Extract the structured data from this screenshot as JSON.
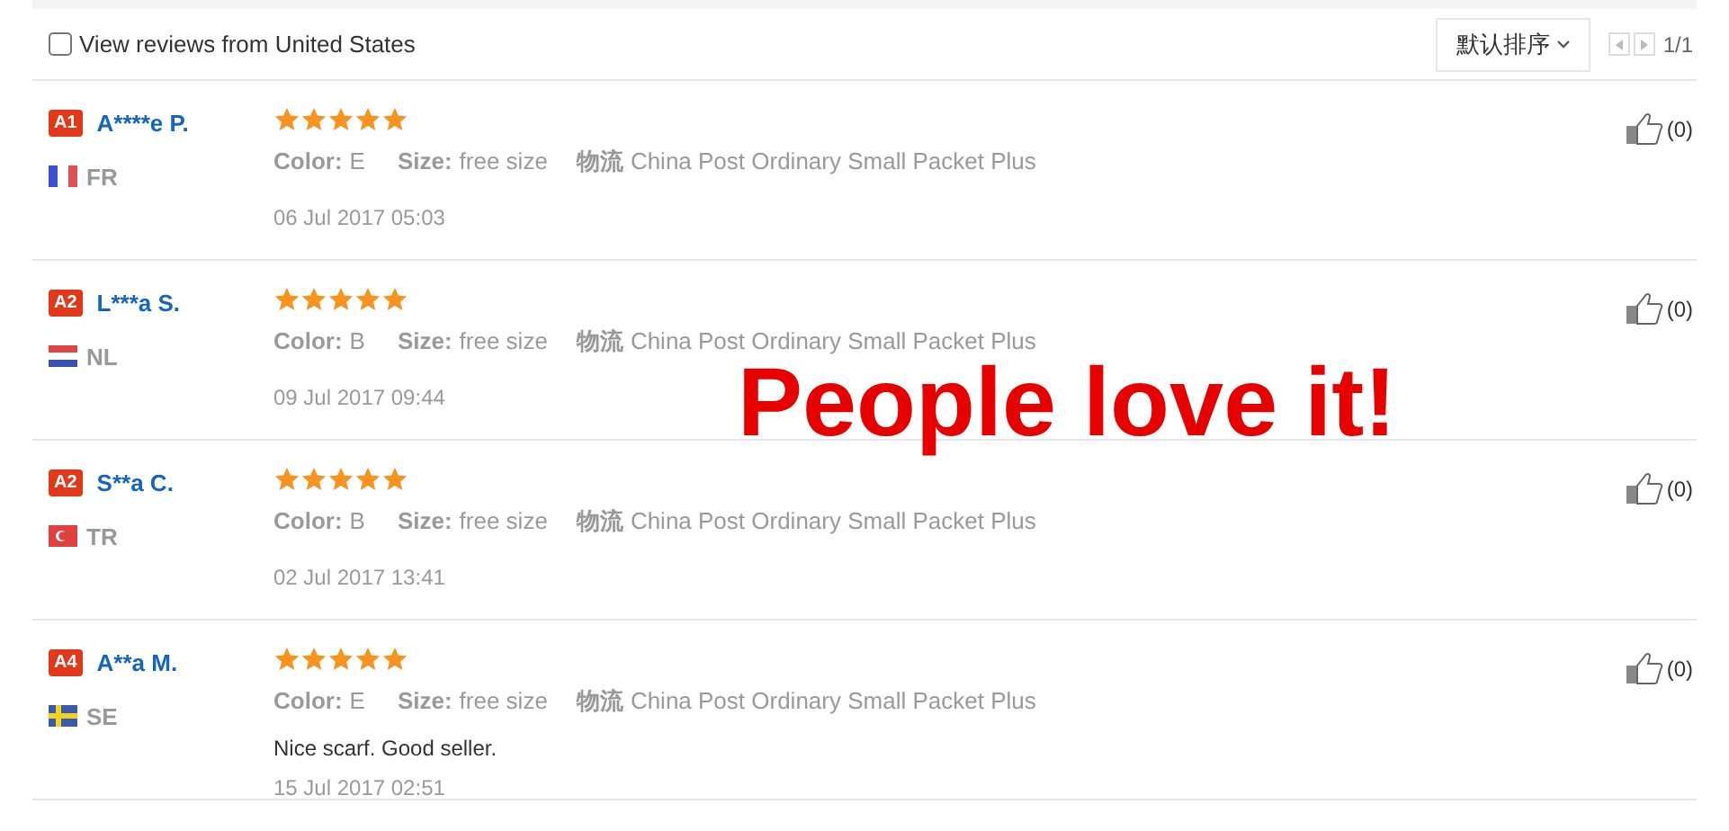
{
  "filter": {
    "label": "View reviews from United States",
    "checked": false
  },
  "sort": {
    "label": "默认排序"
  },
  "pager": {
    "label": "1/1"
  },
  "reviews": [
    {
      "badge": "A1",
      "name": "A****e P.",
      "flag": {
        "kind": "fr"
      },
      "country": "FR",
      "stars": 5,
      "color_label": "Color:",
      "color_value": "E",
      "size_label": "Size:",
      "size": "free size",
      "logistics_label": "物流",
      "logistics": "China Post Ordinary Small Packet Plus",
      "date": "06 Jul 2017 05:03",
      "likes": "(0)"
    },
    {
      "badge": "A2",
      "name": "L***a S.",
      "flag": {
        "kind": "nl"
      },
      "country": "NL",
      "stars": 5,
      "color_label": "Color:",
      "color_value": "B",
      "size_label": "Size:",
      "size": "free size",
      "logistics_label": "物流",
      "logistics": "China Post Ordinary Small Packet Plus",
      "date": "09 Jul 2017 09:44",
      "likes": "(0)"
    },
    {
      "badge": "A2",
      "name": "S**a C.",
      "flag": {
        "kind": "tr"
      },
      "country": "TR",
      "stars": 5,
      "color_label": "Color:",
      "color_value": "B",
      "size_label": "Size:",
      "size": "free size",
      "logistics_label": "物流",
      "logistics": "China Post Ordinary Small Packet Plus",
      "date": "02 Jul 2017 13:41",
      "likes": "(0)"
    },
    {
      "badge": "A4",
      "name": "A**a M.",
      "flag": {
        "kind": "se"
      },
      "country": "SE",
      "stars": 5,
      "color_label": "Color:",
      "color_value": "E",
      "size_label": "Size:",
      "size": "free size",
      "logistics_label": "物流",
      "logistics": "China Post Ordinary Small Packet Plus",
      "comment": "Nice scarf. Good seller.",
      "date": "15 Jul 2017 02:51",
      "likes": "(0)"
    }
  ],
  "overlay": {
    "text": "People love it!"
  }
}
